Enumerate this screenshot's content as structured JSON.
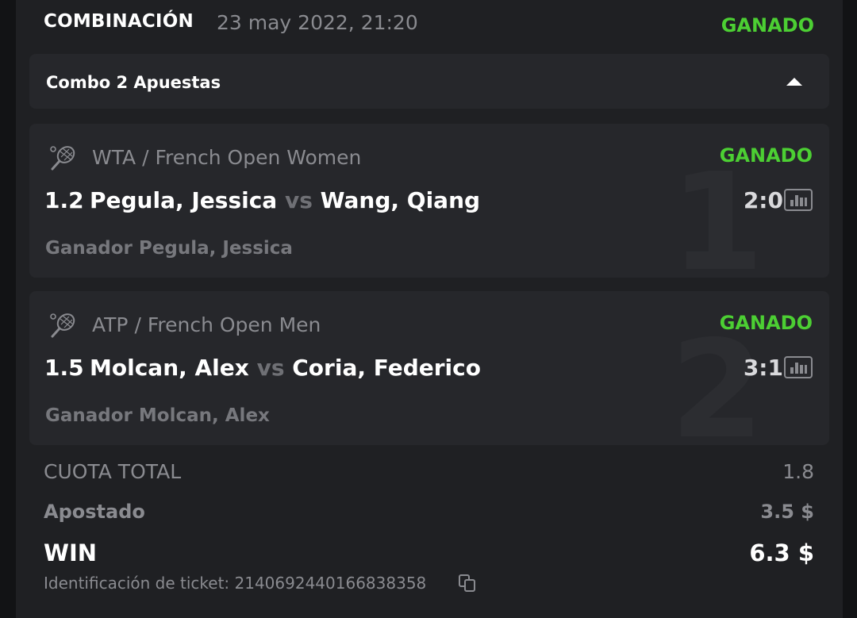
{
  "header": {
    "type": "COMBINACIÓN",
    "date": "23 may 2022, 21:20",
    "status": "GANADO"
  },
  "combo": {
    "title": "Combo 2 Apuestas",
    "caret_icon": "caret-up-icon"
  },
  "events": [
    {
      "index": "1",
      "sport_icon": "tennis-racket-icon",
      "league": "WTA / French Open Women",
      "status": "GANADO",
      "odds": "1.2",
      "home": "Pegula, Jessica",
      "vs": "vs",
      "away": "Wang, Qiang",
      "score": "2:0",
      "selection": "Ganador Pegula, Jessica"
    },
    {
      "index": "2",
      "sport_icon": "tennis-racket-icon",
      "league": "ATP / French Open Men",
      "status": "GANADO",
      "odds": "1.5",
      "home": "Molcan, Alex",
      "vs": "vs",
      "away": "Coria, Federico",
      "score": "3:1",
      "selection": "Ganador Molcan, Alex"
    }
  ],
  "summary": {
    "total_odds_label": "CUOTA TOTAL",
    "total_odds_value": "1.8",
    "staked_label": "Apostado",
    "staked_value": "3.5 $",
    "win_label": "WIN",
    "win_value": "6.3 $",
    "ticket_text": "Identificación de ticket: 2140692440166838358",
    "copy_icon": "copy-icon"
  },
  "colors": {
    "background": "#121315",
    "card": "#1f2023",
    "panel": "#26272b",
    "status_green": "#4ccf33",
    "muted_text": "#8a8b90"
  }
}
